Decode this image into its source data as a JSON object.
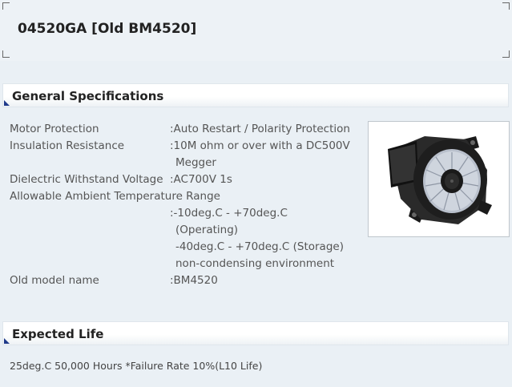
{
  "product": {
    "title": "04520GA [Old BM4520]"
  },
  "sections": {
    "general": {
      "heading": "General Specifications"
    },
    "life": {
      "heading": "Expected Life",
      "text": "25deg.C 50,000 Hours *Failure Rate 10%(L10 Life)"
    }
  },
  "specs": {
    "motor_protection": {
      "label": "Motor Protection",
      "value": ":Auto Restart / Polarity Protection"
    },
    "insulation": {
      "label": "Insulation Resistance",
      "value_line1": ":10M ohm or over with a DC500V",
      "value_line2": "Megger"
    },
    "dielectric": {
      "label": "Dielectric Withstand Voltage",
      "value": ":AC700V 1s"
    },
    "ambient": {
      "label": "Allowable Ambient Temperature Range",
      "value_line1": ":-10deg.C - +70deg.C",
      "value_line2": "(Operating)",
      "value_line3": "-40deg.C - +70deg.C (Storage)",
      "value_line4": "non-condensing environment"
    },
    "old_model": {
      "label": "Old model name",
      "value": ":BM4520"
    }
  },
  "image": {
    "alt": "blower-fan-icon"
  }
}
